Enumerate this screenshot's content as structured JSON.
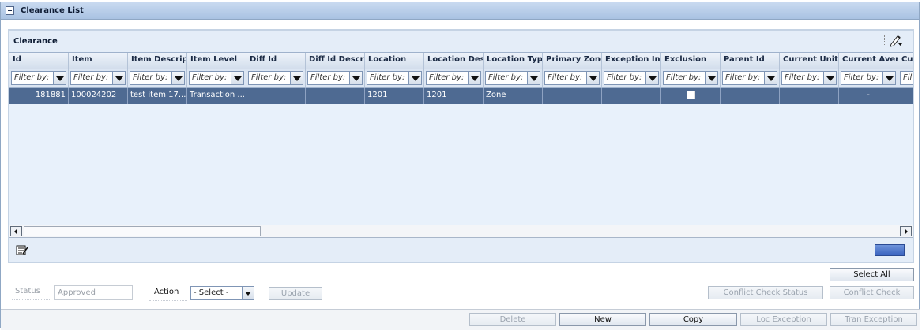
{
  "window": {
    "title": "Clearance List"
  },
  "panel": {
    "title": "Clearance"
  },
  "columns": [
    "Id",
    "Item",
    "Item Descripti",
    "Item Level",
    "Diff Id",
    "Diff Id Descrip",
    "Location",
    "Location Desc",
    "Location Type",
    "Primary Zone",
    "Exception Ind",
    "Exclusion",
    "Parent Id",
    "Current Unit R",
    "Current Avera",
    "Cu"
  ],
  "filter_placeholder": "Filter by:",
  "rows": [
    {
      "id": "181881",
      "item": "100024202",
      "item_description": "test item 17...",
      "item_level": "Transaction ...",
      "diff_id": "",
      "diff_id_description": "",
      "location": "1201",
      "location_description": "1201",
      "location_type": "Zone",
      "primary_zone": "",
      "exception_ind": "",
      "exclusion": false,
      "parent_id": "",
      "current_unit_retail": "",
      "current_average": "-",
      "cu": ""
    }
  ],
  "form": {
    "status_label": "Status",
    "status_value": "Approved",
    "action_label": "Action",
    "action_value": "- Select -",
    "update_label": "Update"
  },
  "buttons": {
    "select_all": "Select All",
    "conflict_check_status": "Conflict Check Status",
    "conflict_check": "Conflict Check",
    "delete": "Delete",
    "new": "New",
    "copy": "Copy",
    "loc_exception": "Loc Exception",
    "tran_exception": "Tran Exception"
  },
  "icons": {
    "collapse": "collapse-icon",
    "edit": "pencil-edit-icon",
    "notes": "notes-icon"
  },
  "colors": {
    "selected_row": "#4e6a92",
    "title_bar": "#b8cde8",
    "panel_bg": "#e4edf8"
  }
}
